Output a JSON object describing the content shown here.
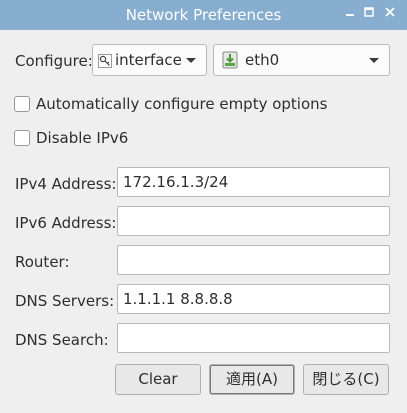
{
  "window": {
    "title": "Network Preferences",
    "minimize_glyph": "🗕",
    "maximize_glyph": "□",
    "close_glyph": "✕"
  },
  "configure": {
    "label": "Configure:",
    "type_value": "interface",
    "type_icon": "key-icon",
    "target_value": "eth0",
    "target_icon": "network-interface-icon"
  },
  "options": {
    "auto_configure": {
      "label": "Automatically configure empty options",
      "checked": false
    },
    "disable_ipv6": {
      "label": "Disable IPv6",
      "checked": false
    }
  },
  "fields": [
    {
      "label": "IPv4 Address:",
      "value": "172.16.1.3/24"
    },
    {
      "label": "IPv6 Address:",
      "value": ""
    },
    {
      "label": "Router:",
      "value": ""
    },
    {
      "label": "DNS Servers:",
      "value": "1.1.1.1 8.8.8.8"
    },
    {
      "label": "DNS Search:",
      "value": ""
    }
  ],
  "buttons": {
    "clear": "Clear",
    "apply": "適用(A)",
    "close": "閉じる(C)"
  },
  "colors": {
    "titlebar": "#87adcf",
    "background": "#efefef"
  }
}
